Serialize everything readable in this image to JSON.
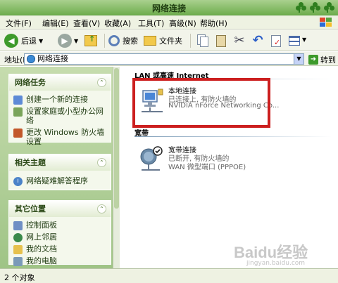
{
  "window": {
    "title": "网络连接"
  },
  "menu": [
    "文件(F)",
    "编辑(E)",
    "查看(V)",
    "收藏(A)",
    "工具(T)",
    "高级(N)",
    "帮助(H)"
  ],
  "toolbar": {
    "back": "后退",
    "search": "搜索",
    "folders": "文件夹"
  },
  "address": {
    "label": "地址(D)",
    "value": "网络连接",
    "go": "转到"
  },
  "left": {
    "tasks": {
      "title": "网络任务",
      "items": [
        "创建一个新的连接",
        "设置家庭或小型办公网络",
        "更改 Windows 防火墙设置"
      ]
    },
    "related": {
      "title": "相关主题",
      "items": [
        "网络疑难解答程序"
      ]
    },
    "other": {
      "title": "其它位置",
      "items": [
        "控制面板",
        "网上邻居",
        "我的文档",
        "我的电脑"
      ]
    }
  },
  "main": {
    "lan_group": "LAN 或高速 Internet",
    "broadband_group": "宽带",
    "lan": {
      "name": "本地连接",
      "status": "已连接上, 有防火墙的",
      "device": "NVIDIA nForce Networking Co..."
    },
    "broadband": {
      "name": "宽带连接",
      "status": "已断开, 有防火墙的",
      "device": "WAN 微型端口 (PPPOE)"
    }
  },
  "status": {
    "count": "2 个对象"
  },
  "watermark": {
    "brand": "Baidu经验",
    "url": "jingyan.baidu.com"
  },
  "colors": {
    "titlebar": "#6fae4e",
    "highlight": "#cc1f1f",
    "pane": "#c6dcae"
  }
}
